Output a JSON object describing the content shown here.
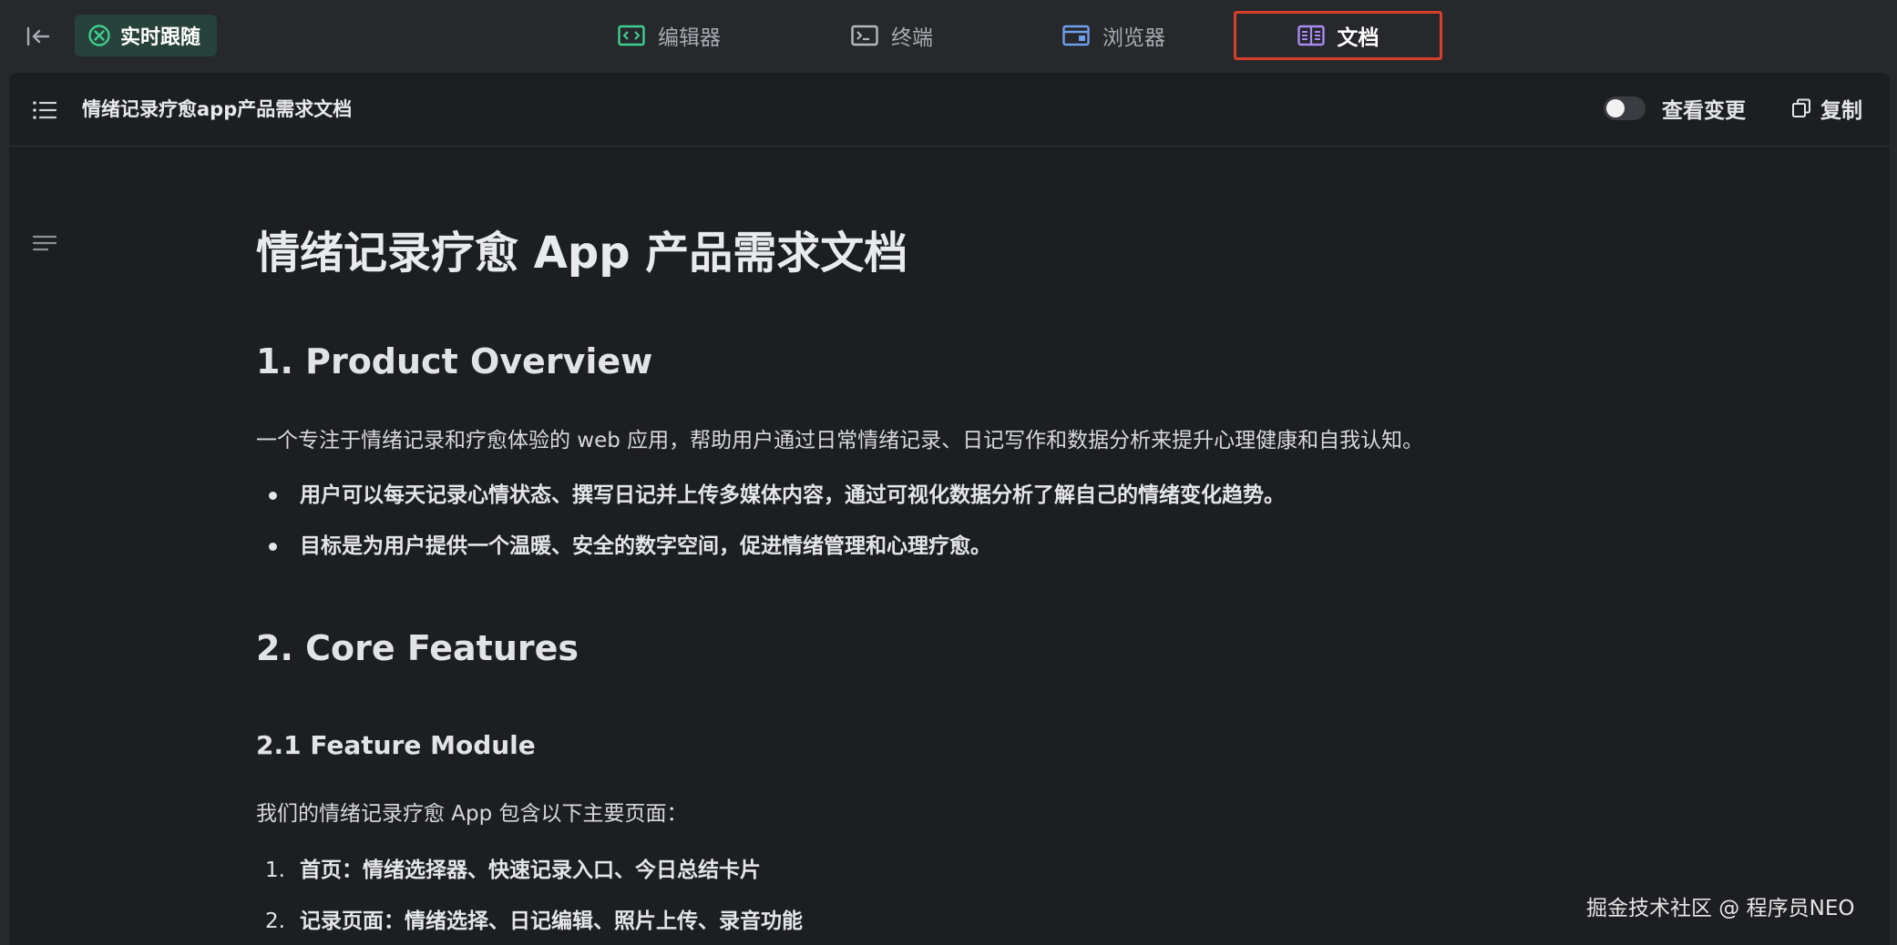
{
  "topbar": {
    "follow_label": "实时跟随",
    "tabs": [
      {
        "label": "编辑器",
        "icon": "code-icon",
        "active": false
      },
      {
        "label": "终端",
        "icon": "terminal-icon",
        "active": false
      },
      {
        "label": "浏览器",
        "icon": "browser-icon",
        "active": false
      },
      {
        "label": "文档",
        "icon": "document-icon",
        "active": true
      }
    ]
  },
  "doc_header": {
    "title": "情绪记录疗愈app产品需求文档",
    "toggle_label": "查看变更",
    "toggle_on": false,
    "copy_label": "复制"
  },
  "document": {
    "h1": "情绪记录疗愈 App 产品需求文档",
    "section1": {
      "heading": "1. Product Overview",
      "paragraph": "一个专注于情绪记录和疗愈体验的 web 应用，帮助用户通过日常情绪记录、日记写作和数据分析来提升心理健康和自我认知。",
      "bullets": [
        "用户可以每天记录心情状态、撰写日记并上传多媒体内容，通过可视化数据分析了解自己的情绪变化趋势。",
        "目标是为用户提供一个温暖、安全的数字空间，促进情绪管理和心理疗愈。"
      ]
    },
    "section2": {
      "heading": "2. Core Features",
      "subheading": "2.1 Feature Module",
      "paragraph": "我们的情绪记录疗愈 App 包含以下主要页面：",
      "items": [
        {
          "num": "1.",
          "text": "首页：情绪选择器、快速记录入口、今日总结卡片"
        },
        {
          "num": "2.",
          "text": "记录页面：情绪选择、日记编辑、照片上传、录音功能"
        }
      ]
    }
  },
  "watermark": "掘金技术社区 @ 程序员NEO",
  "colors": {
    "accent_green": "#3ecf8e",
    "tab_icon_blue": "#6f9eea",
    "tab_icon_purple": "#a98bf0",
    "highlight_border": "#d5402c"
  }
}
